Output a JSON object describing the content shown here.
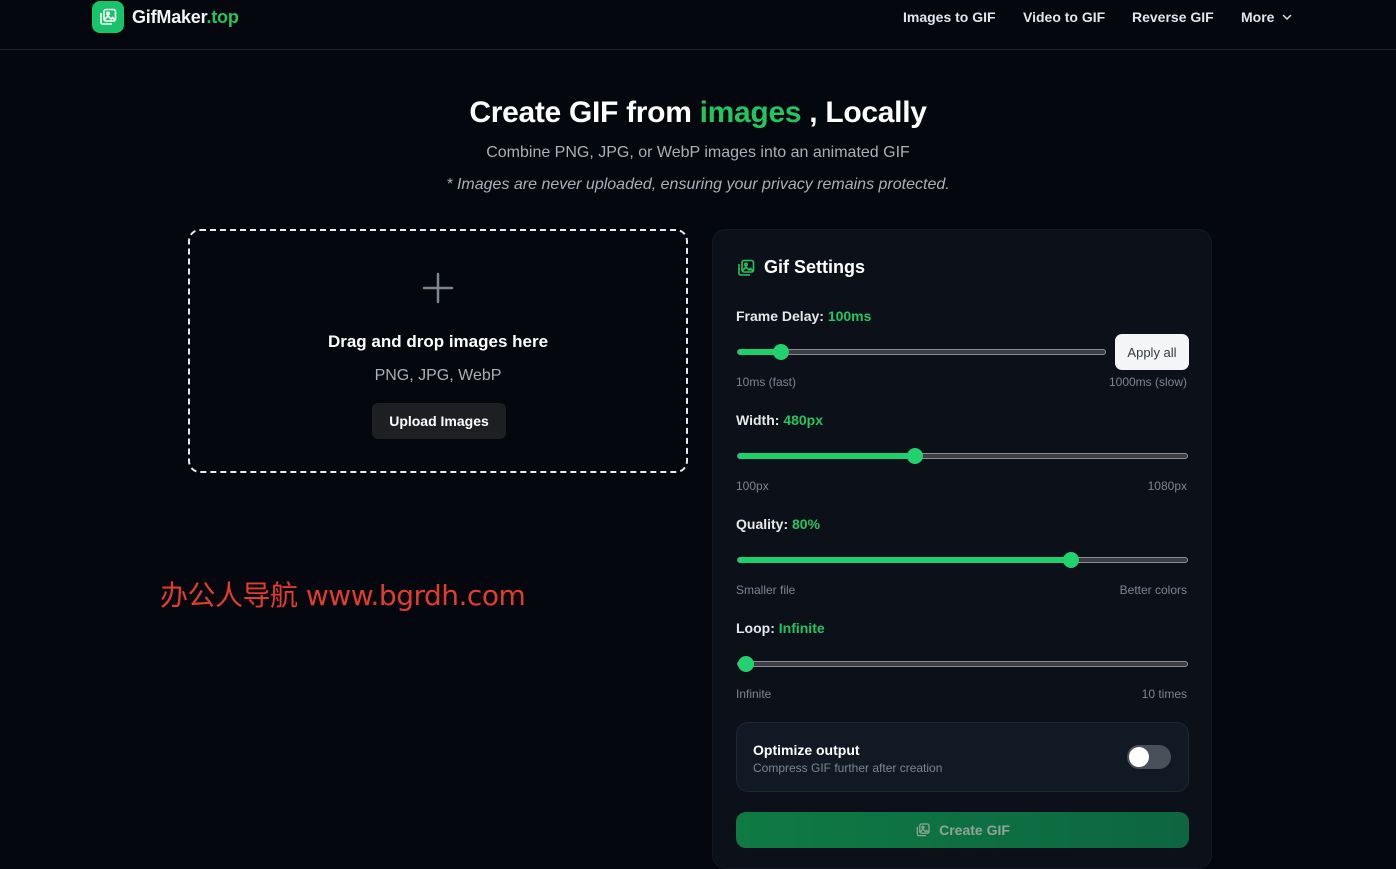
{
  "header": {
    "brand": "GifMaker",
    "brand_tld": ".top",
    "nav": [
      {
        "label": "Images to GIF"
      },
      {
        "label": "Video to GIF"
      },
      {
        "label": "Reverse GIF"
      },
      {
        "label": "More"
      }
    ]
  },
  "hero": {
    "title_prefix": "Create GIF from",
    "title_accent": "images",
    "title_suffix": ", Locally",
    "subtitle": "Combine PNG, JPG, or WebP images into an animated GIF",
    "note": "* Images are never uploaded, ensuring your privacy remains protected."
  },
  "dropzone": {
    "title": "Drag and drop images here",
    "formats": "PNG, JPG, WebP",
    "button_label": "Upload Images"
  },
  "watermark": "办公人导航 www.bgrdh.com",
  "settings": {
    "title": "Gif Settings",
    "frame_delay": {
      "label": "Frame Delay:",
      "value_text": "100ms",
      "fraction": 0.1,
      "min_label": "10ms (fast)",
      "max_label": "1000ms (slow)",
      "apply_label": "Apply all"
    },
    "width": {
      "label": "Width:",
      "value_text": "480px",
      "fraction": 0.39,
      "min_label": "100px",
      "max_label": "1080px"
    },
    "quality": {
      "label": "Quality:",
      "value_text": "80%",
      "fraction": 0.75,
      "min_label": "Smaller file",
      "max_label": "Better colors"
    },
    "loop": {
      "label": "Loop:",
      "value_text": "Infinite",
      "fraction": 0.0,
      "min_label": "Infinite",
      "max_label": "10 times"
    },
    "optimize": {
      "title": "Optimize output",
      "description": "Compress GIF further after creation",
      "enabled": false
    },
    "create_label": "Create GIF"
  },
  "colors": {
    "accent": "#22c55e",
    "background": "#04070d",
    "panel": "#0b1019"
  }
}
